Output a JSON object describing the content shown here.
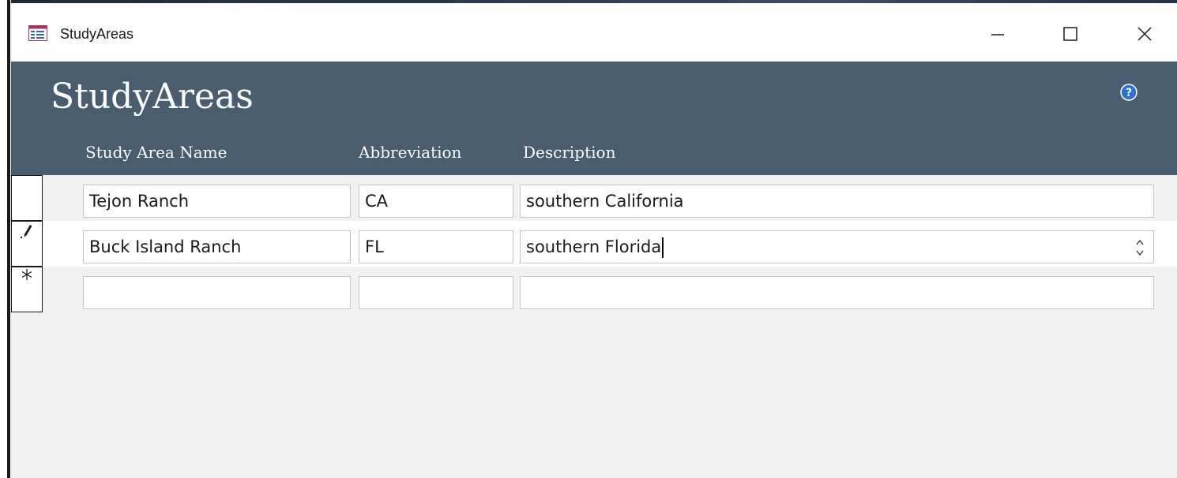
{
  "window": {
    "title": "StudyAreas",
    "controls": {
      "minimize_icon": "minimize-icon",
      "maximize_icon": "maximize-icon",
      "close_icon": "close-icon"
    }
  },
  "form": {
    "title": "StudyAreas",
    "help_icon": "help-icon",
    "columns": {
      "name": "Study Area Name",
      "abbreviation": "Abbreviation",
      "description": "Description"
    }
  },
  "records": [
    {
      "name": "Tejon Ranch",
      "abbreviation": "CA",
      "description": "southern California",
      "selector": ""
    },
    {
      "name": "Buck Island Ranch",
      "abbreviation": "FL",
      "description": "southern Florida",
      "selector": "edit-pencil-icon"
    },
    {
      "name": "",
      "abbreviation": "",
      "description": "",
      "selector": "new-record-asterisk-icon"
    }
  ],
  "colors": {
    "header_bg": "#4a5d6e",
    "detail_bg": "#f1f1f1",
    "help_icon": "#2c6fd6"
  }
}
